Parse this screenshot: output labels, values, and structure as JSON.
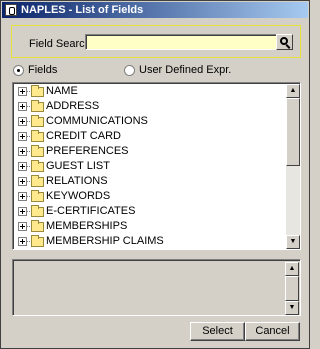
{
  "window": {
    "title": "NAPLES - List of Fields"
  },
  "search": {
    "label": "Field Search",
    "value": "",
    "placeholder": ""
  },
  "radios": {
    "fields": {
      "label": "Fields",
      "checked": true
    },
    "user_defined": {
      "label": "User Defined Expr.",
      "checked": false
    }
  },
  "tree": {
    "items": [
      {
        "label": "NAME"
      },
      {
        "label": "ADDRESS"
      },
      {
        "label": "COMMUNICATIONS"
      },
      {
        "label": "CREDIT CARD"
      },
      {
        "label": "PREFERENCES"
      },
      {
        "label": "GUEST LIST"
      },
      {
        "label": "RELATIONS"
      },
      {
        "label": "KEYWORDS"
      },
      {
        "label": "E-CERTIFICATES"
      },
      {
        "label": "MEMBERSHIPS"
      },
      {
        "label": "MEMBERSHIP CLAIMS"
      }
    ]
  },
  "buttons": {
    "select": "Select",
    "cancel": "Cancel"
  },
  "icons": {
    "search": "search-icon",
    "folder": "folder-icon",
    "expand": "plus-icon"
  }
}
